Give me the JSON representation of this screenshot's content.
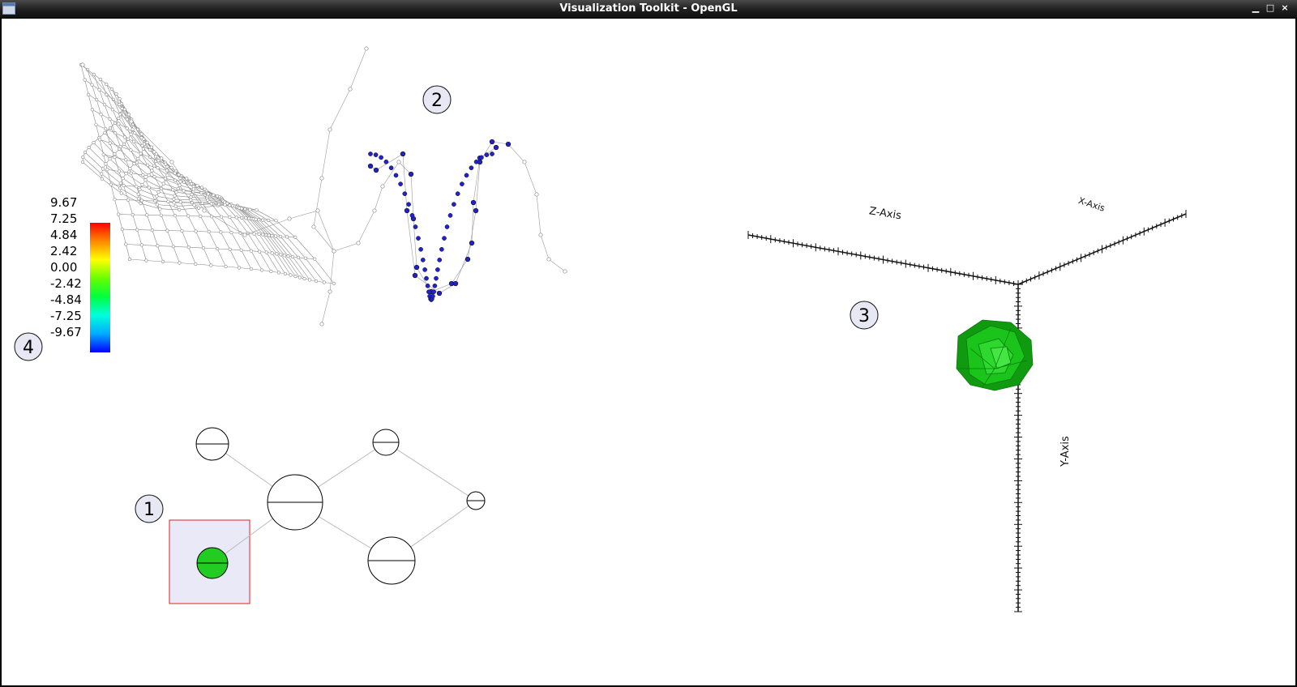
{
  "window": {
    "title": "Visualization Toolkit - OpenGL",
    "minimize_glyph": "▁",
    "maximize_glyph": "□",
    "close_glyph": "×"
  },
  "markers": [
    "1",
    "2",
    "3",
    "4"
  ],
  "scalar_bar": {
    "labels": [
      "9.67",
      "7.25",
      "4.84",
      "2.42",
      "0.00",
      "-2.42",
      "-4.84",
      "-7.25",
      "-9.67"
    ],
    "colors": [
      "#0000ff",
      "#00aaff",
      "#00ffdd",
      "#00ff40",
      "#66ff00",
      "#ffff00",
      "#ff8800",
      "#ff0000"
    ]
  },
  "axes": {
    "z_label": "Z-Axis",
    "x_label": "X-Axis",
    "y_label": "Y-Axis"
  },
  "colors": {
    "selection_fill": "#e9e9f8",
    "selection_border": "#dd2222",
    "selected_node": "#22cc22",
    "marker_fill": "#e8e8f4",
    "isosurface": "#19c719",
    "highlight_vertex": "#2222cc"
  }
}
